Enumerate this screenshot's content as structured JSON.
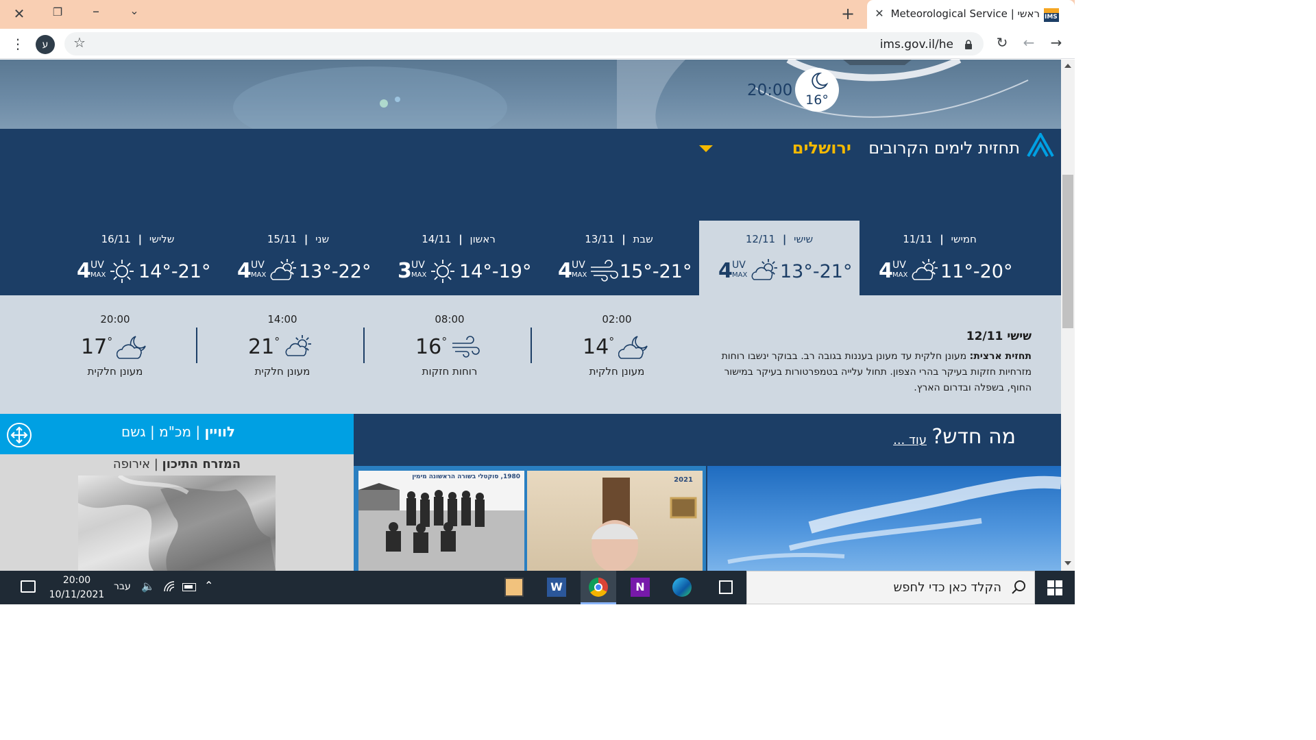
{
  "browser": {
    "tab_title": "ראשי | Israel Meteorological Service",
    "url": "ims.gov.il/he",
    "profile_letter": "ע"
  },
  "hero": {
    "time": "20:00",
    "temp": "16°"
  },
  "forecast": {
    "title": "תחזית לימים הקרובים",
    "city": "ירושלים",
    "days": [
      {
        "name": "חמישי",
        "date": "11/11",
        "uv": "4",
        "temps": "11°-20°",
        "icon": "partly-cloudy-icon"
      },
      {
        "name": "שישי",
        "date": "12/11",
        "uv": "4",
        "temps": "13°-21°",
        "icon": "partly-cloudy-icon",
        "selected": true
      },
      {
        "name": "שבת",
        "date": "13/11",
        "uv": "4",
        "temps": "15°-21°",
        "icon": "wind-icon"
      },
      {
        "name": "ראשון",
        "date": "14/11",
        "uv": "3",
        "temps": "14°-19°",
        "icon": "sun-icon"
      },
      {
        "name": "שני",
        "date": "15/11",
        "uv": "4",
        "temps": "13°-22°",
        "icon": "partly-cloudy-icon"
      },
      {
        "name": "שלישי",
        "date": "16/11",
        "uv": "4",
        "temps": "14°-21°",
        "icon": "sun-icon"
      }
    ],
    "uv_label": "UV",
    "uv_max": "MAX"
  },
  "detail": {
    "heading": "שישי 12/11",
    "text_bold": "תחזית ארצית:",
    "text": "מעונן חלקית עד מעונן בעננות בגובה רב. בבוקר ינשבו רוחות מזרחיות חזקות בעיקר בהרי הצפון. תחול עלייה בטמפרטורות בעיקר במישור החוף, בשפלה ובדרום הארץ.",
    "hours": [
      {
        "time": "02:00",
        "temp": "14",
        "desc": "מעונן חלקית",
        "icon": "cloud-moon-icon"
      },
      {
        "time": "08:00",
        "temp": "16",
        "desc": "רוחות חזקות",
        "icon": "wind-icon"
      },
      {
        "time": "14:00",
        "temp": "21",
        "desc": "מעונן חלקית",
        "icon": "partly-cloudy-icon"
      },
      {
        "time": "20:00",
        "temp": "17",
        "desc": "מעונן חלקית",
        "icon": "cloud-moon-icon"
      }
    ]
  },
  "radar": {
    "tab1": "לוויין",
    "tab2": "מכ\"מ",
    "tab3": "גשם",
    "region1": "המזרח התיכון",
    "region2": "אירופה"
  },
  "news": {
    "title": "מה חדש?",
    "more": "עוד ...",
    "photo1_caption": "1980, סוקטלי בשורה הראשונה מימין",
    "photo2_caption": "2021"
  },
  "taskbar": {
    "search_placeholder": "הקלד כאן כדי לחפש",
    "clock_time": "20:00",
    "clock_date": "10/11/2021",
    "lang": "עבר"
  },
  "colors": {
    "navy": "#1c3e66",
    "light": "#cfd8e1",
    "accent_yellow": "#f5b900",
    "cyan": "#00a0e3"
  }
}
